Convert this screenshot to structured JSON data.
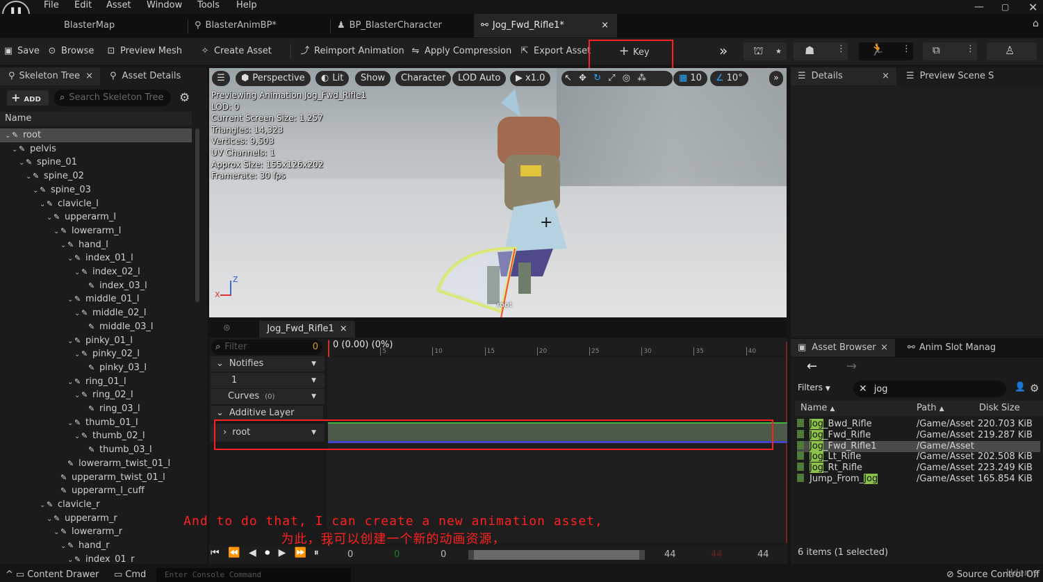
{
  "menu": [
    "File",
    "Edit",
    "Asset",
    "Window",
    "Tools",
    "Help"
  ],
  "doc_tabs": [
    "BlasterMap",
    "BlasterAnimBP*",
    "BP_BlasterCharacter",
    "Jog_Fwd_Rifle1*"
  ],
  "doc_tab_close": "×",
  "toolbar": {
    "save": "Save",
    "browse": "Browse",
    "preview_mesh": "Preview Mesh",
    "create_asset": "Create Asset",
    "reimport": "Reimport Animation",
    "apply_compression": "Apply Compression",
    "export_asset": "Export Asset",
    "key": "Key"
  },
  "left_panel": {
    "tabs": [
      "Skeleton Tree",
      "Asset Details"
    ],
    "add_label": "ADD",
    "search_placeholder": "Search Skeleton Tree",
    "col_name": "Name",
    "bones": [
      {
        "n": "root",
        "d": 0,
        "a": true
      },
      {
        "n": "pelvis",
        "d": 1,
        "a": true
      },
      {
        "n": "spine_01",
        "d": 2,
        "a": true
      },
      {
        "n": "spine_02",
        "d": 3,
        "a": true
      },
      {
        "n": "spine_03",
        "d": 4,
        "a": true
      },
      {
        "n": "clavicle_l",
        "d": 5,
        "a": true
      },
      {
        "n": "upperarm_l",
        "d": 6,
        "a": true
      },
      {
        "n": "lowerarm_l",
        "d": 7,
        "a": true
      },
      {
        "n": "hand_l",
        "d": 8,
        "a": true
      },
      {
        "n": "index_01_l",
        "d": 9,
        "a": true
      },
      {
        "n": "index_02_l",
        "d": 10,
        "a": true
      },
      {
        "n": "index_03_l",
        "d": 11,
        "a": false
      },
      {
        "n": "middle_01_l",
        "d": 9,
        "a": true
      },
      {
        "n": "middle_02_l",
        "d": 10,
        "a": true
      },
      {
        "n": "middle_03_l",
        "d": 11,
        "a": false
      },
      {
        "n": "pinky_01_l",
        "d": 9,
        "a": true
      },
      {
        "n": "pinky_02_l",
        "d": 10,
        "a": true
      },
      {
        "n": "pinky_03_l",
        "d": 11,
        "a": false
      },
      {
        "n": "ring_01_l",
        "d": 9,
        "a": true
      },
      {
        "n": "ring_02_l",
        "d": 10,
        "a": true
      },
      {
        "n": "ring_03_l",
        "d": 11,
        "a": false
      },
      {
        "n": "thumb_01_l",
        "d": 9,
        "a": true
      },
      {
        "n": "thumb_02_l",
        "d": 10,
        "a": true
      },
      {
        "n": "thumb_03_l",
        "d": 11,
        "a": false
      },
      {
        "n": "lowerarm_twist_01_l",
        "d": 8,
        "a": false
      },
      {
        "n": "upperarm_twist_01_l",
        "d": 7,
        "a": false
      },
      {
        "n": "upperarm_l_cuff",
        "d": 7,
        "a": false
      },
      {
        "n": "clavicle_r",
        "d": 5,
        "a": true
      },
      {
        "n": "upperarm_r",
        "d": 6,
        "a": true
      },
      {
        "n": "lowerarm_r",
        "d": 7,
        "a": true
      },
      {
        "n": "hand_r",
        "d": 8,
        "a": true
      },
      {
        "n": "index_01_r",
        "d": 9,
        "a": true
      }
    ]
  },
  "viewport": {
    "perspective": "Perspective",
    "lit": "Lit",
    "show": "Show",
    "character": "Character",
    "lod": "LOD Auto",
    "speed": "x1.0",
    "grid": "10",
    "angle": "10°",
    "info": [
      "Previewing Animation Jog_Fwd_Rifle1",
      "LOD: 0",
      "Current Screen Size: 1.257",
      "Triangles: 14,323",
      "Vertices: 9,503",
      "UV Channels: 1",
      "Approx Size: 155x126x202",
      "Framerate: 30 fps"
    ],
    "root_label": "root",
    "axis_x": "X",
    "axis_z": "Z"
  },
  "timeline": {
    "tab": "Jog_Fwd_Rifle1",
    "filter_placeholder": "Filter",
    "filter_count": "0",
    "current": "0 (0.00) (0%)",
    "ticks": [
      "0",
      "5",
      "10",
      "15",
      "20",
      "25",
      "30",
      "35",
      "40"
    ],
    "notifies": "Notifies",
    "notify_track": "1",
    "curves": "Curves",
    "curves_count": "(0)",
    "additive": "Additive Layer Tracks",
    "root_track": "root",
    "bottom": [
      "0",
      "0",
      "0",
      "44",
      "44",
      "44"
    ]
  },
  "right_panel": {
    "tabs": [
      "Details",
      "Preview Scene S"
    ],
    "asset_tabs": [
      "Asset Browser",
      "Anim Slot Manag"
    ],
    "filters": "Filters",
    "search_value": "jog",
    "cols": [
      "Name",
      "Path",
      "Disk Size"
    ],
    "assets": [
      {
        "pre": "",
        "hl": "Jog",
        "post": "_Bwd_Rifle",
        "path": "/Game/Asset",
        "size": "220.703 KiB"
      },
      {
        "pre": "",
        "hl": "Jog",
        "post": "_Fwd_Rifle",
        "path": "/Game/Asset",
        "size": "219.287 KiB"
      },
      {
        "pre": "",
        "hl": "Jog",
        "post": "_Fwd_Rifle1",
        "path": "/Game/Asset",
        "size": ""
      },
      {
        "pre": "",
        "hl": "Jog",
        "post": "_Lt_Rifle",
        "path": "/Game/Asset",
        "size": "202.508 KiB"
      },
      {
        "pre": "",
        "hl": "Jog",
        "post": "_Rt_Rifle",
        "path": "/Game/Asset",
        "size": "223.249 KiB"
      },
      {
        "pre": "Jump_From_",
        "hl": "Jog",
        "post": "",
        "path": "/Game/Asset",
        "size": "165.854 KiB"
      }
    ],
    "count": "6 items (1 selected)"
  },
  "subtitle": {
    "en": "And to do that, I can create a new animation asset,",
    "zh": "为此，我可以创建一个新的动画资源，"
  },
  "status": {
    "content_drawer": "Content Drawer",
    "cmd": "Cmd",
    "console_placeholder": "Enter Console Command",
    "source_control": "Source Control Off",
    "watermark": "Udemy"
  },
  "colors": {
    "accent_red": "#ff2020",
    "highlight_green": "#8bc34a",
    "selected_row": "#4a4a4a"
  }
}
